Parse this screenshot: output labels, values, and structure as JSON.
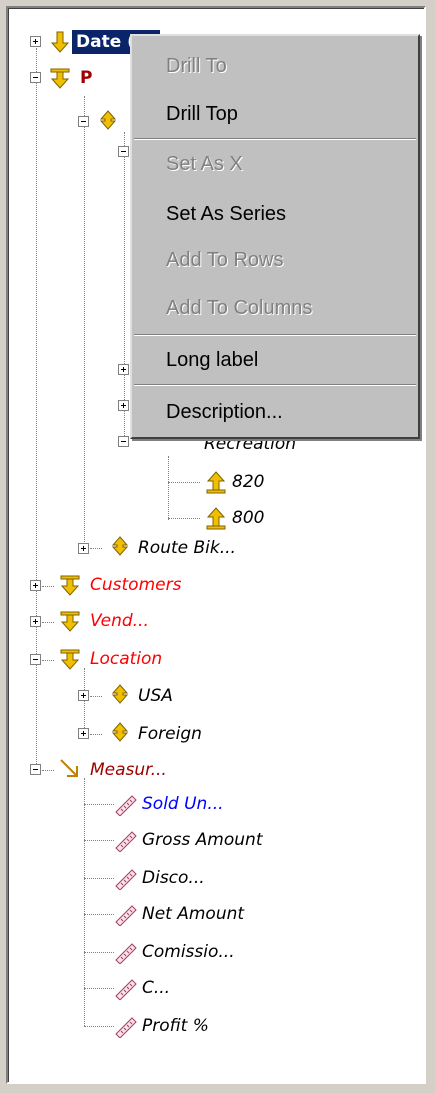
{
  "tree": {
    "nodes": [
      {
        "label": "Date (X)",
        "color": "#ffffff"
      },
      {
        "label": "P",
        "color": "#a00000"
      },
      {
        "label": "",
        "color": "#000000"
      },
      {
        "label": "Recreation",
        "color": "#000000"
      },
      {
        "label": "820",
        "color": "#000000"
      },
      {
        "label": "800",
        "color": "#000000"
      },
      {
        "label": "Route Bik...",
        "color": "#000000"
      },
      {
        "label": "Customers",
        "color": "#ff0000"
      },
      {
        "label": "Vend...",
        "color": "#ff0000"
      },
      {
        "label": "Location",
        "color": "#ff0000"
      },
      {
        "label": "USA",
        "color": "#000000"
      },
      {
        "label": "Foreign",
        "color": "#000000"
      },
      {
        "label": "Measur...",
        "color": "#a00000"
      },
      {
        "label": "Sold Un...",
        "color": "#0000ff"
      },
      {
        "label": "Gross Amount",
        "color": "#000000"
      },
      {
        "label": "Disco...",
        "color": "#000000"
      },
      {
        "label": "Net Amount",
        "color": "#000000"
      },
      {
        "label": "Comissio...",
        "color": "#000000"
      },
      {
        "label": "C...",
        "color": "#000000"
      },
      {
        "label": "Profit %",
        "color": "#000000"
      }
    ]
  },
  "context_menu": {
    "items": [
      {
        "label": "Drill To",
        "enabled": false
      },
      {
        "label": "Drill Top",
        "enabled": true
      },
      {
        "label": "Set As X",
        "enabled": false
      },
      {
        "label": "Set As Series",
        "enabled": true
      },
      {
        "label": "Add To Rows",
        "enabled": false
      },
      {
        "label": "Add To Columns",
        "enabled": false
      },
      {
        "label": "Long label",
        "enabled": true
      },
      {
        "label": "Description...",
        "enabled": true
      }
    ]
  },
  "colors": {
    "selection": "#0a246a",
    "dimension_icon": "#f0c000",
    "measure_icon": "#e08080",
    "menu_bg": "#c0c0c0"
  }
}
